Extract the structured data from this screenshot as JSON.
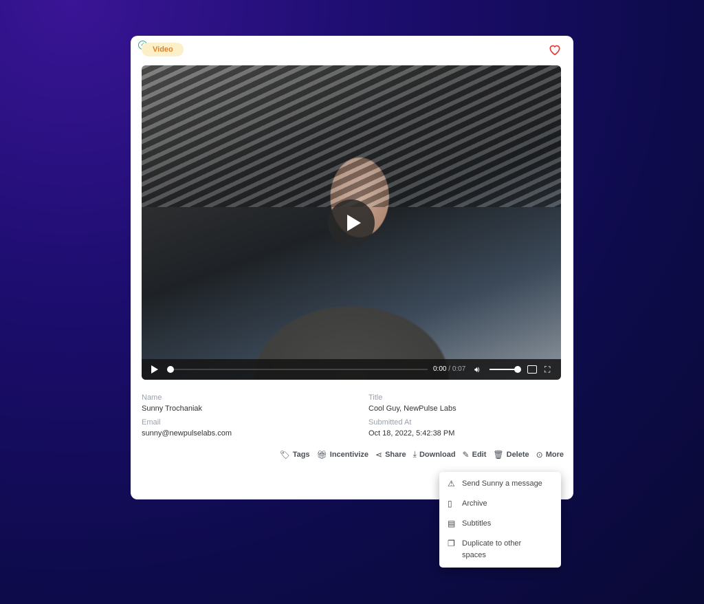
{
  "card": {
    "badge": "Video",
    "favorite": false
  },
  "player": {
    "current_time": "0:00",
    "separator": " / ",
    "duration": "0:07",
    "progress": 0,
    "volume": 1
  },
  "fields": {
    "name_label": "Name",
    "name": "Sunny Trochaniak",
    "email_label": "Email",
    "email": "sunny@newpulselabs.com",
    "title_label": "Title",
    "title": "Cool Guy, NewPulse Labs",
    "submitted_label": "Submitted At",
    "submitted": "Oct 18, 2022, 5:42:38 PM"
  },
  "actions": [
    {
      "label": "Tags",
      "icon": "tag-icon"
    },
    {
      "label": "Incentivize",
      "icon": "gift-icon"
    },
    {
      "label": "Share",
      "icon": "share-icon"
    },
    {
      "label": "Download",
      "icon": "download-icon"
    },
    {
      "label": "Edit",
      "icon": "edit-icon"
    },
    {
      "label": "Delete",
      "icon": "trash-icon"
    },
    {
      "label": "More",
      "icon": "more-icon"
    }
  ],
  "menu": [
    {
      "label": "Send Sunny a message",
      "icon": "warning-icon"
    },
    {
      "label": "Archive",
      "icon": "bookmark-icon"
    },
    {
      "label": "Subtitles",
      "icon": "subtitles-icon"
    },
    {
      "label": "Duplicate to other spaces",
      "icon": "copy-icon"
    }
  ],
  "colors": {
    "badge_text": "#d9822b",
    "badge_bg": "#fdf0c8",
    "heart": "#e53935",
    "check": "#2fa88a"
  }
}
